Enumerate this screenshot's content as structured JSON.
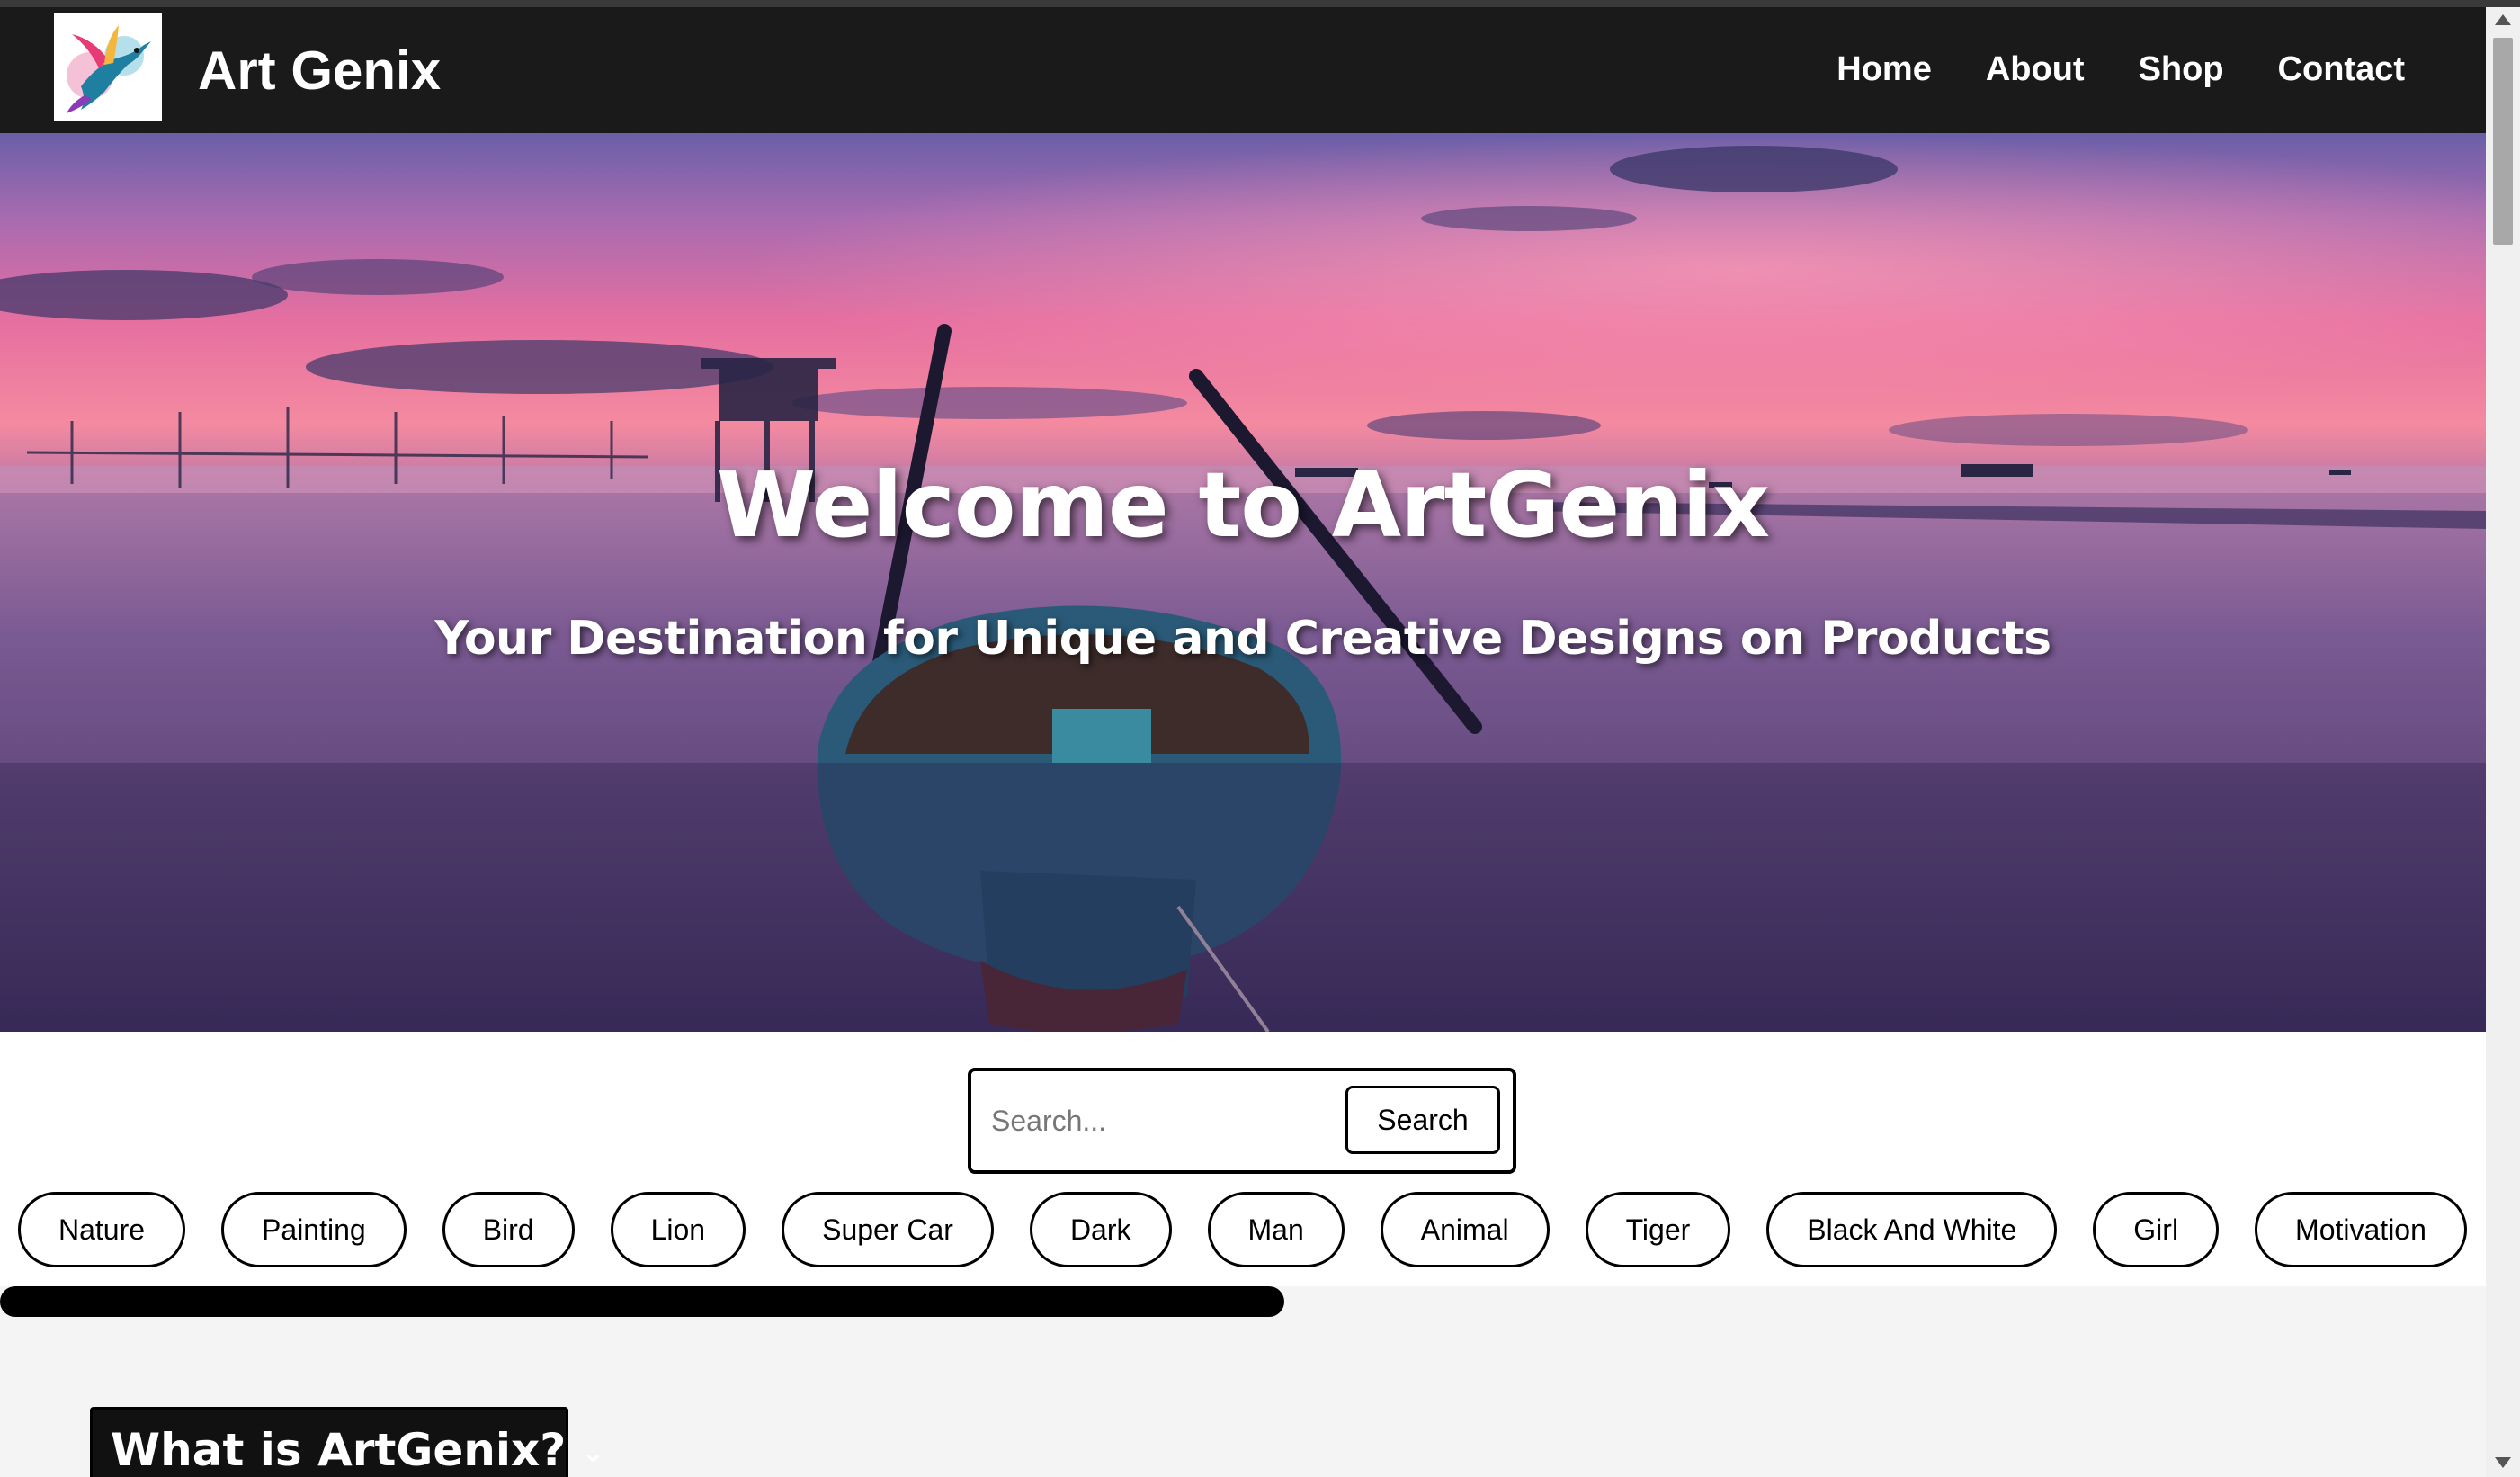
{
  "header": {
    "brand": "Art Genix",
    "logo_icon": "hummingbird-logo",
    "nav": [
      "Home",
      "About",
      "Shop",
      "Contact"
    ]
  },
  "hero": {
    "title": "Welcome to ArtGenix",
    "subtitle": "Your Destination for Unique and Creative Designs on Products"
  },
  "search": {
    "placeholder": "Search...",
    "button_label": "Search"
  },
  "tags": [
    "Nature",
    "Painting",
    "Bird",
    "Lion",
    "Super Car",
    "Dark",
    "Man",
    "Animal",
    "Tiger",
    "Black And White",
    "Girl",
    "Motivation"
  ],
  "faq": {
    "question": "What is ArtGenix?",
    "icon": "chevron-down-icon"
  },
  "colors": {
    "nav_bg": "#1a1a1a",
    "text_on_dark": "#ffffff",
    "page_bg": "#f4f4f4"
  }
}
